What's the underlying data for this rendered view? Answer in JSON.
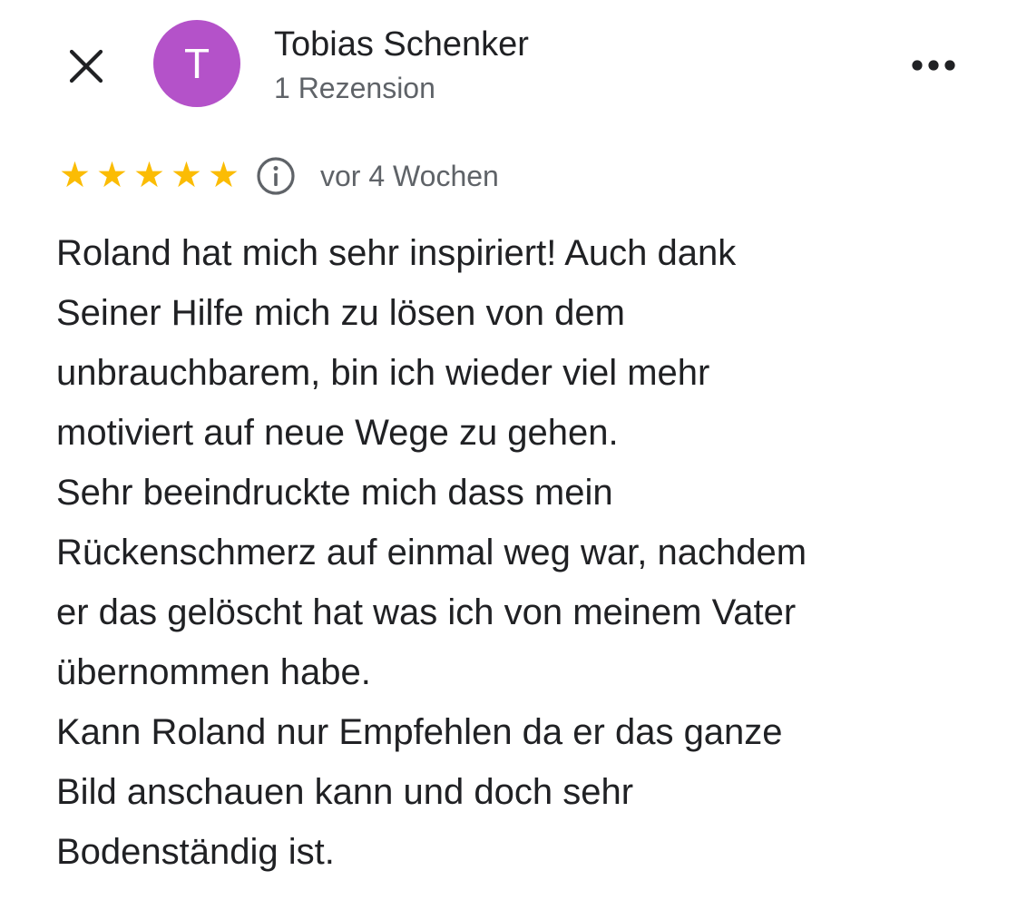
{
  "header": {
    "close_icon": "close-icon",
    "avatar": {
      "letter": "T",
      "color": "#b452c9"
    },
    "author_name": "Tobias Schenker",
    "author_review_count": "1 Rezension",
    "more_icon": "more-horizontal-icon"
  },
  "review": {
    "rating": 5,
    "max_rating": 5,
    "star_color": "#fbbc04",
    "info_icon": "info-icon",
    "date": "vor 4 Wochen",
    "lines": [
      "Roland hat mich sehr inspiriert! Auch dank",
      "Seiner Hilfe mich zu lösen von dem",
      "unbrauchbarem, bin ich wieder viel mehr",
      "motiviert auf neue Wege zu gehen.",
      "Sehr beeindruckte mich dass mein",
      "Rückenschmerz auf einmal weg war, nachdem",
      "er das gelöscht hat was ich von meinem Vater",
      "übernommen habe.",
      "Kann Roland nur Empfehlen da er das ganze",
      "Bild anschauen kann und doch sehr",
      "Bodenständig ist."
    ]
  }
}
